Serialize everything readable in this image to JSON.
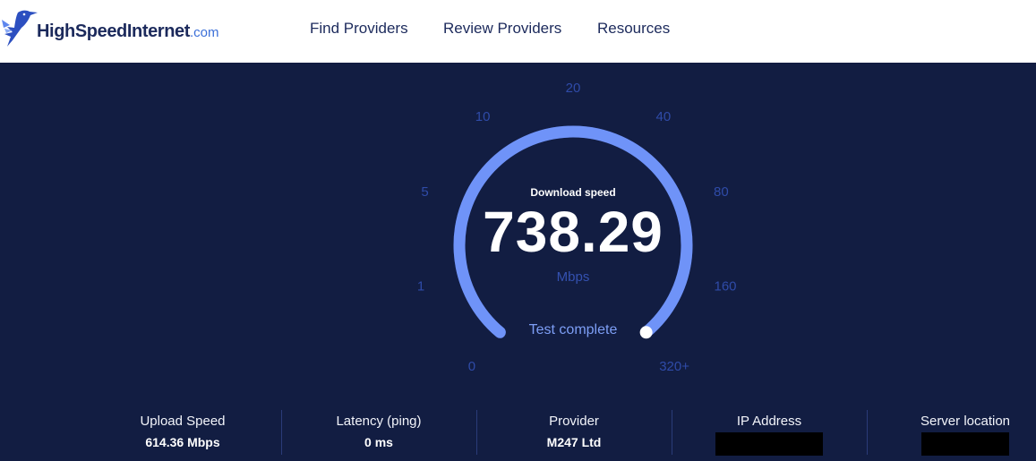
{
  "header": {
    "logo": {
      "name": "HighSpeedInternet",
      "suffix": ".com"
    },
    "nav": [
      {
        "label": "Find Providers"
      },
      {
        "label": "Review Providers"
      },
      {
        "label": "Resources"
      }
    ]
  },
  "gauge": {
    "title": "Download speed",
    "value": "738.29",
    "unit": "Mbps",
    "status": "Test complete",
    "ticks": [
      "0",
      "1",
      "5",
      "10",
      "20",
      "40",
      "80",
      "160",
      "320+"
    ],
    "level_fraction": 1.0,
    "arc_color": "#6f93f8",
    "tick_color": "#2f4ba8"
  },
  "stats": [
    {
      "label": "Upload Speed",
      "value": "614.36 Mbps"
    },
    {
      "label": "Latency (ping)",
      "value": "0 ms"
    },
    {
      "label": "Provider",
      "value": "M247 Ltd"
    },
    {
      "label": "IP Address",
      "value": "",
      "redacted": true
    },
    {
      "label": "Server location",
      "value": "",
      "redacted": true
    }
  ],
  "colors": {
    "background": "#121d42",
    "header_background": "#ffffff",
    "nav_text": "#1c2a5c",
    "accent": "#3b6fd8"
  }
}
